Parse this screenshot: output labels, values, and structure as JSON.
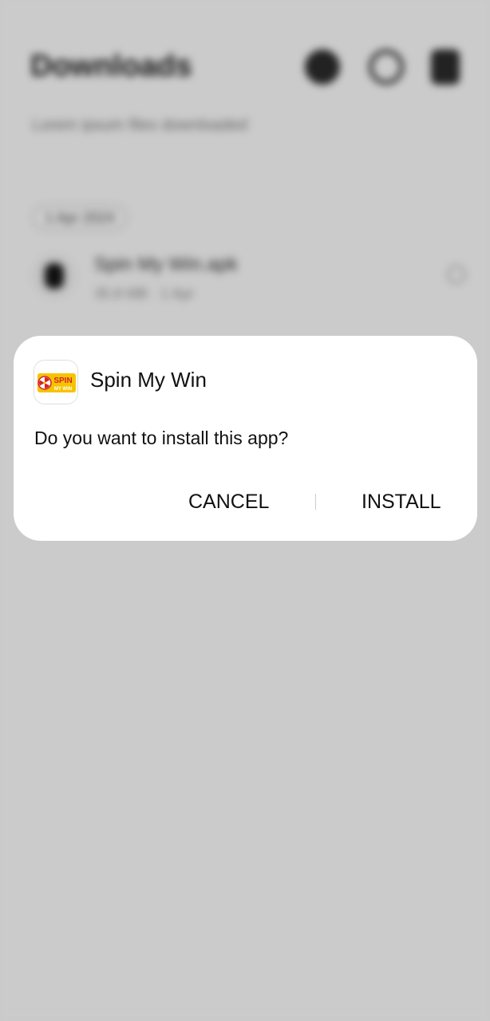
{
  "background": {
    "title": "Downloads",
    "subtitle": "Lorem ipsum files downloaded",
    "chip_label": "1 Apr 2024",
    "row_title": "Spin My Win.apk",
    "row_subtitle": "35.8 MB · 1 Apr",
    "icons": [
      "info-icon",
      "search-icon",
      "more-options-icon"
    ]
  },
  "dialog": {
    "app_name": "Spin My Win",
    "app_icon": "spin-my-win-logo",
    "logo_text_top": "SPIN",
    "logo_text_bottom": "MY WIN",
    "message": "Do you want to install this app?",
    "cancel_label": "CANCEL",
    "install_label": "INSTALL"
  },
  "colors": {
    "scrim": "#000000",
    "dialog_bg": "#ffffff",
    "logo_yellow": "#f5c400",
    "logo_red": "#d8232a"
  }
}
